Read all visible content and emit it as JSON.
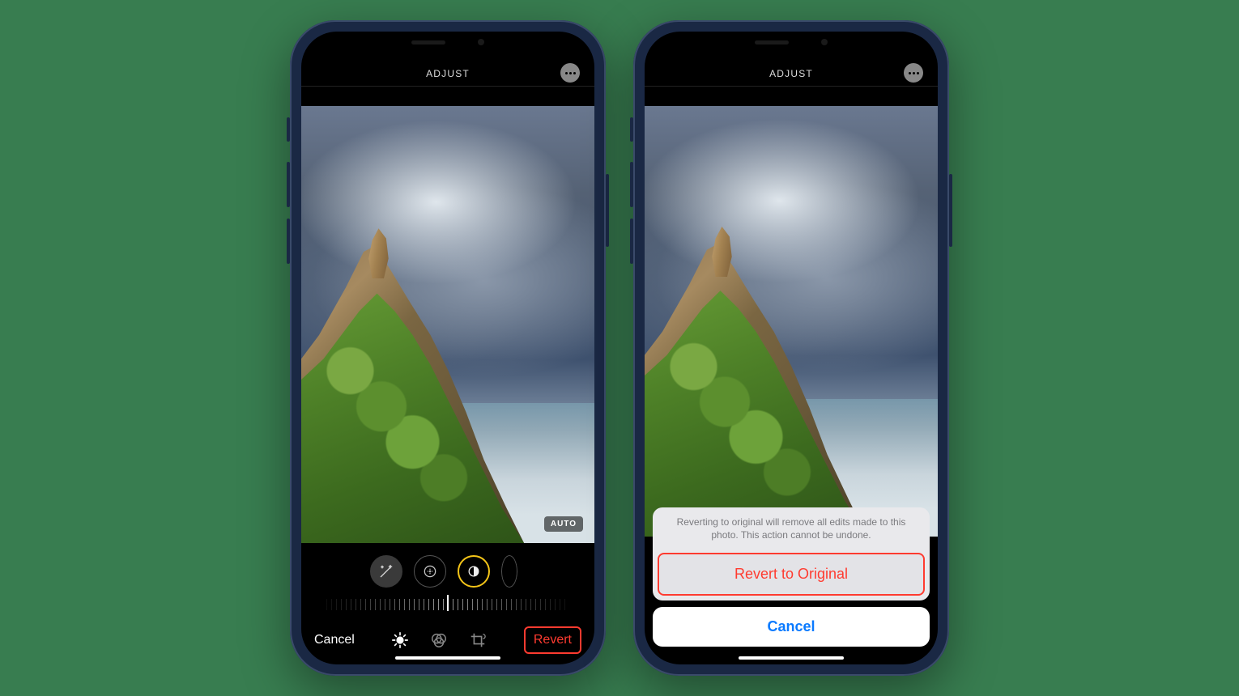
{
  "header": {
    "title": "ADJUST"
  },
  "badge": {
    "auto": "AUTO"
  },
  "bottom": {
    "cancel": "Cancel",
    "revert": "Revert"
  },
  "actionsheet": {
    "message": "Reverting to original will remove all edits made to this photo. This action cannot be undone.",
    "revert": "Revert to Original",
    "cancel": "Cancel"
  },
  "icons": {
    "more": "more-icon",
    "wand": "wand-icon",
    "exposure": "exposure-icon",
    "brilliance": "brilliance-icon",
    "adjust": "adjust-icon",
    "filters": "filters-icon",
    "crop": "crop-icon"
  }
}
